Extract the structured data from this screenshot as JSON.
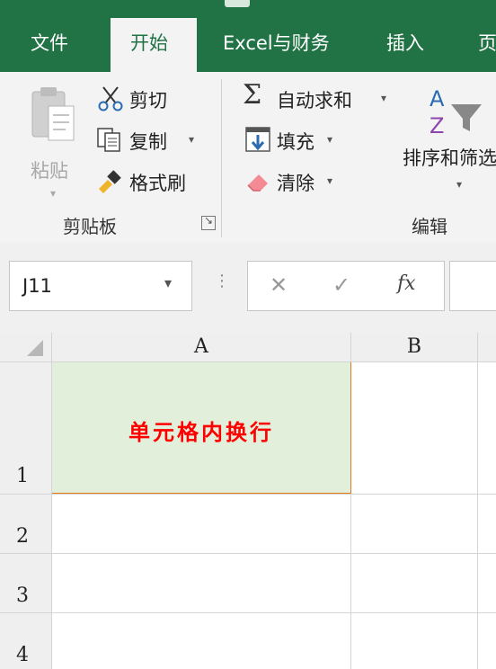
{
  "tabs": [
    {
      "label": "文件",
      "active": false
    },
    {
      "label": "开始",
      "active": true
    },
    {
      "label": "Excel与财务",
      "active": false
    },
    {
      "label": "插入",
      "active": false
    },
    {
      "label": "页",
      "active": false
    }
  ],
  "clipboard": {
    "paste_label": "粘贴",
    "cut_label": "剪切",
    "copy_label": "复制",
    "format_painter_label": "格式刷",
    "group_label": "剪贴板"
  },
  "editing": {
    "autosum_label": "自动求和",
    "fill_label": "填充",
    "clear_label": "清除",
    "sort_filter_label": "排序和筛选",
    "group_label": "编辑"
  },
  "formula_bar": {
    "name_box_value": "J11",
    "fx_label": "fx"
  },
  "grid": {
    "columns": [
      "A",
      "B"
    ],
    "rows": [
      "1",
      "2",
      "3",
      "4"
    ],
    "cell_a1_text": "单元格内换行",
    "cell_a1_fill": "#e2efda",
    "cell_a1_text_color": "#ff0000",
    "selection_border_color": "#e07b17"
  },
  "colors": {
    "ribbon_green": "#217346",
    "ribbon_bg": "#f3f3f3"
  }
}
